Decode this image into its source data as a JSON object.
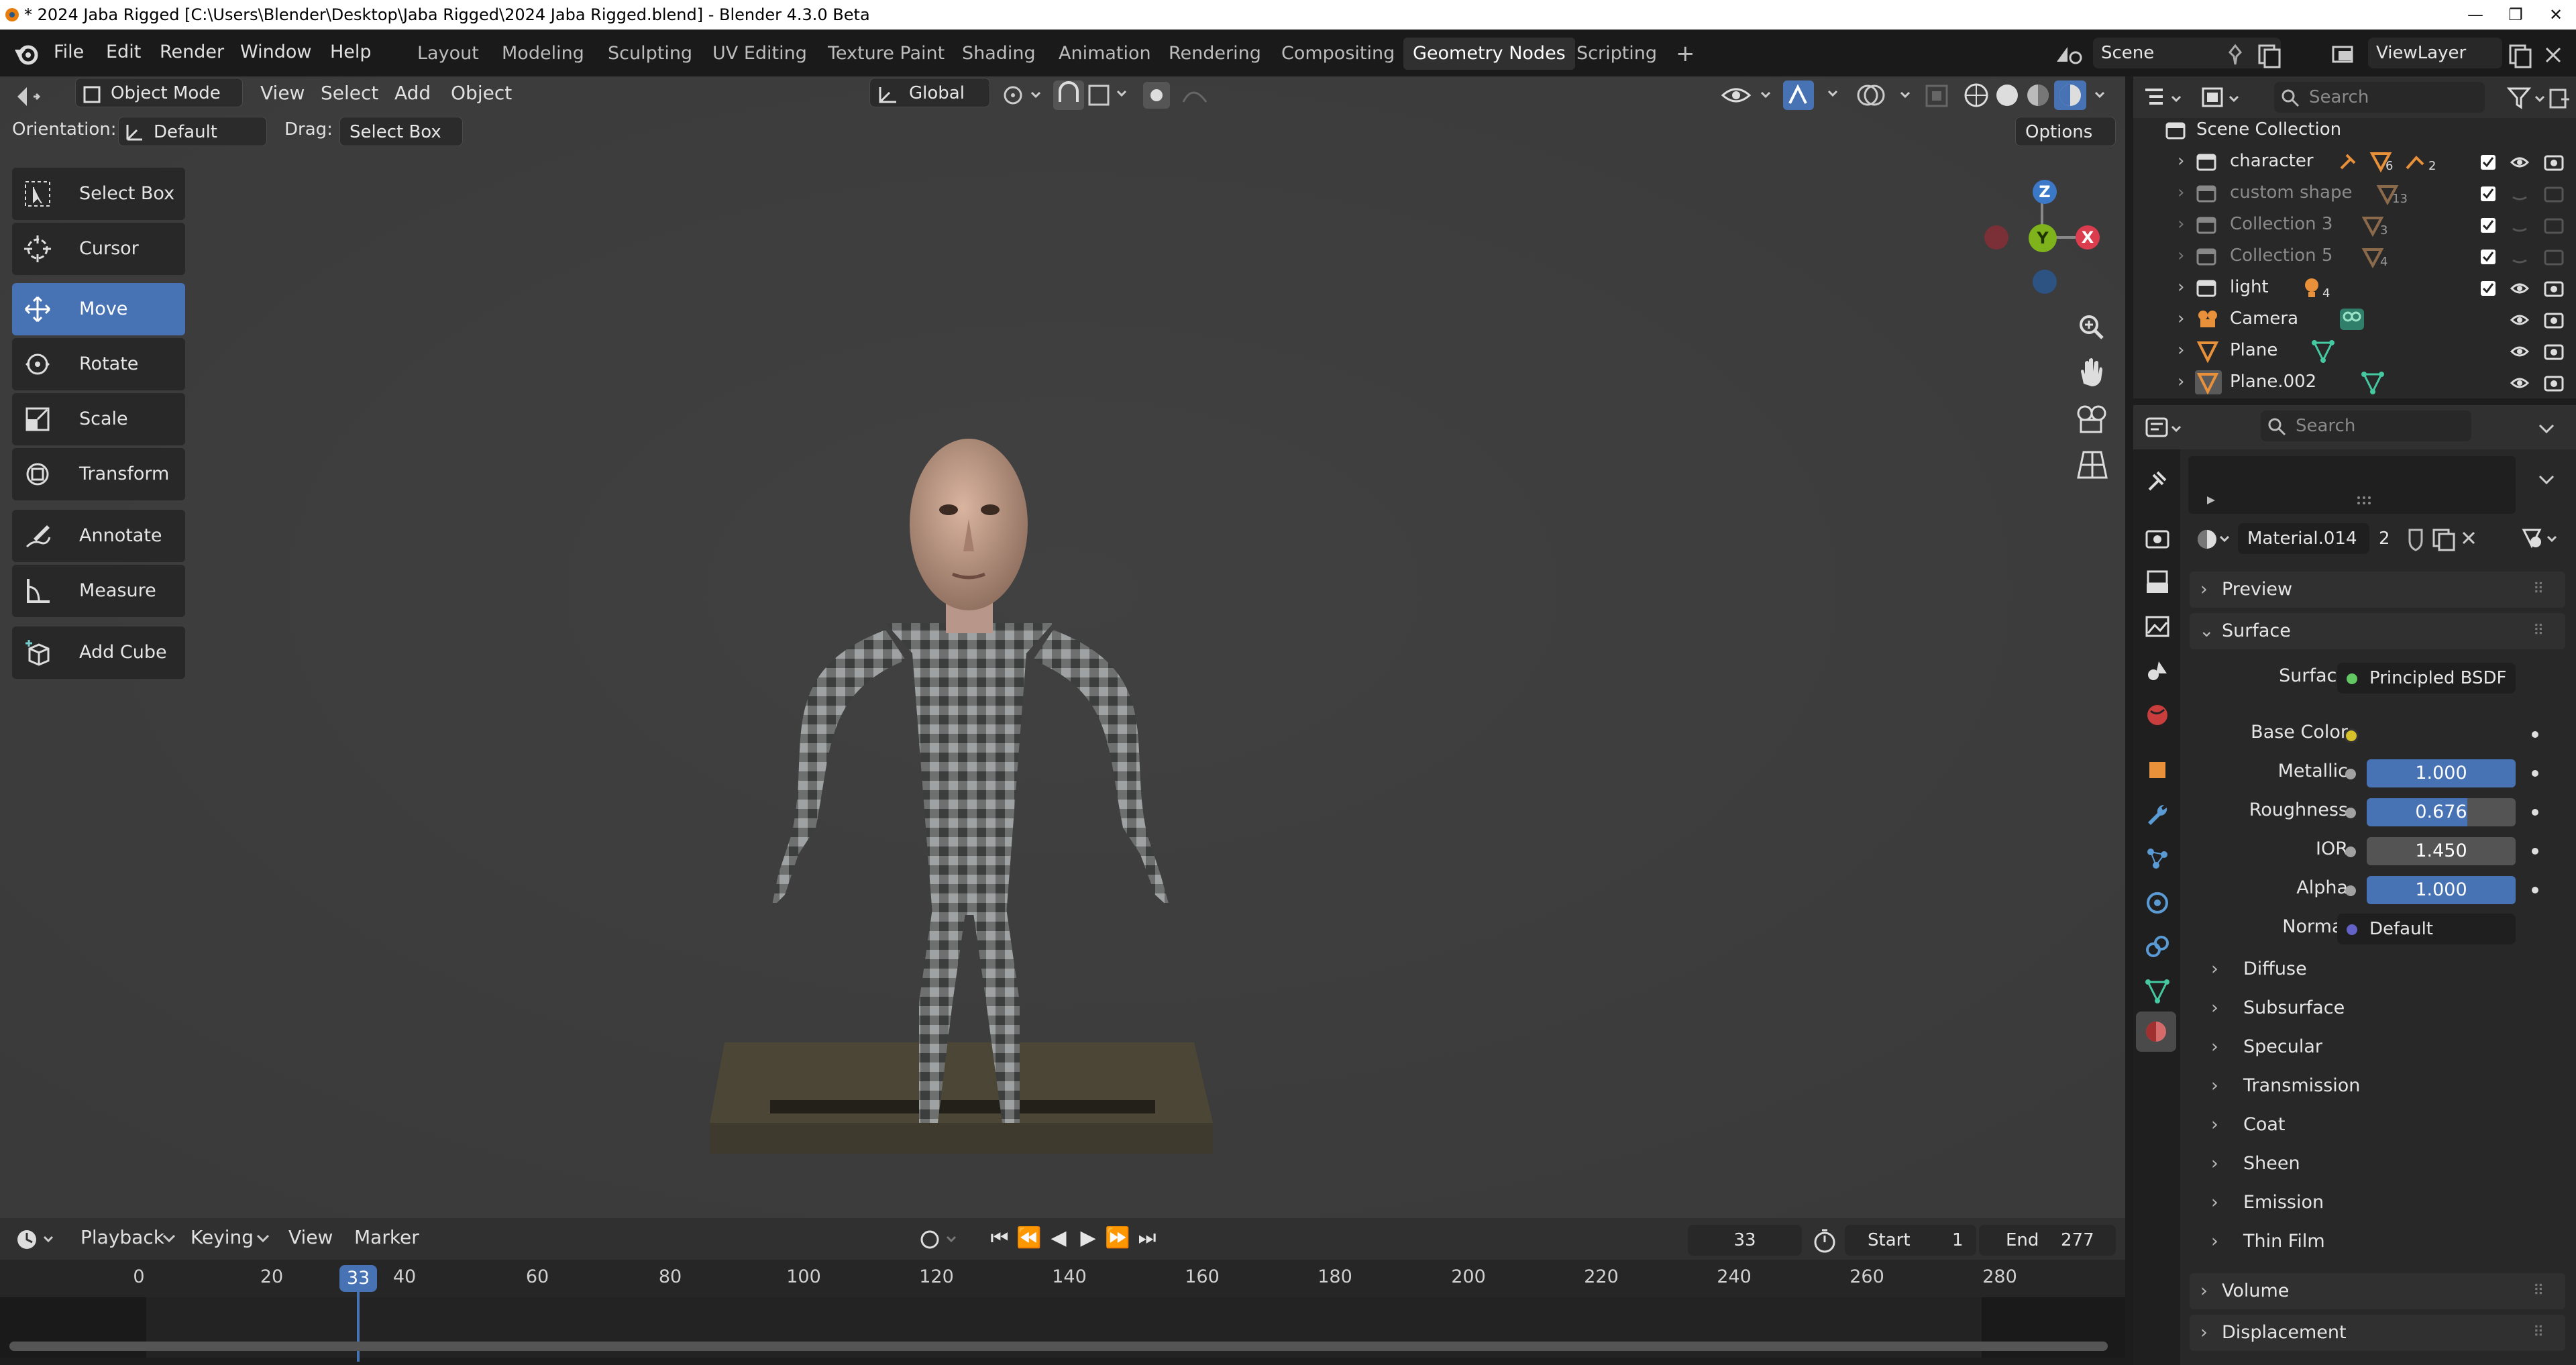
{
  "window": {
    "title": "* 2024 Jaba Rigged [C:\\Users\\Blender\\Desktop\\Jaba Rigged\\2024 Jaba Rigged.blend] - Blender 4.3.0 Beta",
    "minimize": "—",
    "restore": "❐",
    "close": "✕"
  },
  "menu": [
    "File",
    "Edit",
    "Render",
    "Window",
    "Help"
  ],
  "workspaces": [
    "Layout",
    "Modeling",
    "Sculpting",
    "UV Editing",
    "Texture Paint",
    "Shading",
    "Animation",
    "Rendering",
    "Compositing",
    "Geometry Nodes",
    "Scripting"
  ],
  "active_workspace": "Geometry Nodes",
  "add_workspace": "+",
  "scene": {
    "name": "Scene",
    "view_layer": "ViewLayer"
  },
  "viewport_header": {
    "mode": "Object Mode",
    "menus": [
      "View",
      "Select",
      "Add",
      "Object"
    ],
    "transform_orientation": "Global",
    "orientation_label": "Orientation:",
    "orientation_value": "Default",
    "drag_label": "Drag:",
    "drag_value": "Select Box",
    "options": "Options"
  },
  "tools": [
    {
      "label": "Select Box",
      "icon": "select-box-icon"
    },
    {
      "label": "Cursor",
      "icon": "cursor-icon"
    },
    {
      "label": "Move",
      "icon": "move-icon",
      "active": true
    },
    {
      "label": "Rotate",
      "icon": "rotate-icon"
    },
    {
      "label": "Scale",
      "icon": "scale-icon"
    },
    {
      "label": "Transform",
      "icon": "transform-icon"
    },
    {
      "label": "Annotate",
      "icon": "annotate-icon"
    },
    {
      "label": "Measure",
      "icon": "measure-icon"
    },
    {
      "label": "Add Cube",
      "icon": "add-cube-icon"
    }
  ],
  "gizmo": {
    "z": "Z",
    "y": "Y",
    "x": "X"
  },
  "outliner": {
    "search_placeholder": "Search",
    "root": "Scene Collection",
    "items": [
      {
        "label": "character",
        "badge1": "6",
        "badge2": "2",
        "dim": false
      },
      {
        "label": "custom shape",
        "badge1": "13",
        "dim": true
      },
      {
        "label": "Collection 3",
        "badge1": "3",
        "dim": true
      },
      {
        "label": "Collection 5",
        "badge1": "4",
        "dim": true
      },
      {
        "label": "light",
        "badge1": "4",
        "dim": false
      },
      {
        "label": "Camera",
        "dim": false
      },
      {
        "label": "Plane",
        "dim": false
      },
      {
        "label": "Plane.002",
        "dim": false
      }
    ]
  },
  "properties": {
    "search_placeholder": "Search",
    "material_name": "Material.014",
    "material_users": "2",
    "sections": {
      "preview": "Preview",
      "surface": "Surface",
      "volume": "Volume",
      "displacement": "Displacement"
    },
    "surface_label": "Surface",
    "surface_value": "Principled BSDF",
    "base_color_label": "Base Color",
    "base_color": "#d6c12a",
    "params": [
      {
        "label": "Metallic",
        "value": "1.000",
        "fraction": 1.0
      },
      {
        "label": "Roughness",
        "value": "0.676",
        "fraction": 0.676
      },
      {
        "label": "IOR",
        "value": "1.450",
        "fraction": 0
      },
      {
        "label": "Alpha",
        "value": "1.000",
        "fraction": 1.0
      }
    ],
    "normal_label": "Normal",
    "normal_value": "Default",
    "subsections": [
      "Diffuse",
      "Subsurface",
      "Specular",
      "Transmission",
      "Coat",
      "Sheen",
      "Emission",
      "Thin Film"
    ]
  },
  "timeline": {
    "menus": [
      "Playback",
      "Keying",
      "View",
      "Marker"
    ],
    "current_frame": "33",
    "start_label": "Start",
    "start": "1",
    "end_label": "End",
    "end": "277",
    "ticks": [
      "0",
      "20",
      "40",
      "60",
      "80",
      "100",
      "120",
      "140",
      "160",
      "180",
      "200",
      "220",
      "240",
      "260",
      "280"
    ],
    "playhead": "33"
  }
}
